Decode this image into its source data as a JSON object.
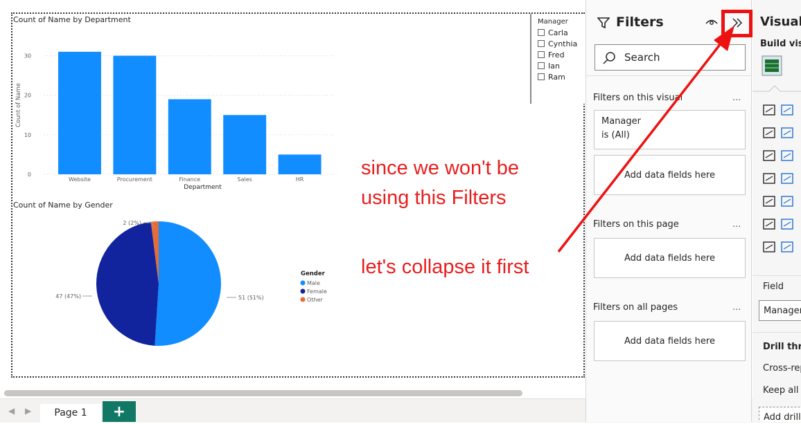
{
  "charts": {
    "bar": {
      "title": "Count of Name by Department",
      "ylabel": "Count of Name",
      "xlabel": "Department",
      "yticks": [
        "0",
        "10",
        "20",
        "30"
      ]
    },
    "pie": {
      "title": "Count of Name by Gender",
      "legend_title": "Gender",
      "legend": [
        "Male",
        "Female",
        "Other"
      ],
      "labels": [
        "51 (51%)",
        "47 (47%)",
        "2 (2%)"
      ]
    }
  },
  "chart_data": [
    {
      "type": "bar",
      "title": "Count of Name by Department",
      "xlabel": "Department",
      "ylabel": "Count of Name",
      "categories": [
        "Website",
        "Procurement",
        "Finance",
        "Sales",
        "HR"
      ],
      "values": [
        31,
        30,
        19,
        15,
        5
      ],
      "ylim": [
        0,
        35
      ],
      "color": "#118dff",
      "grid": true
    },
    {
      "type": "pie",
      "title": "Count of Name by Gender",
      "categories": [
        "Male",
        "Female",
        "Other"
      ],
      "values": [
        51,
        47,
        2
      ],
      "colors": [
        "#118dff",
        "#12239e",
        "#e66c37"
      ],
      "legend_position": "right"
    }
  ],
  "slicer": {
    "title": "Manager",
    "items": [
      "Carla",
      "Cynthia",
      "Fred",
      "Ian",
      "Ram"
    ]
  },
  "annotation": {
    "line1": "since we won't be",
    "line2": "using this Filters",
    "line3": "let's collapse it first",
    "color": "#e81e1e"
  },
  "filters": {
    "title": "Filters",
    "search_placeholder": "Search",
    "section_visual": "Filters on this visual",
    "card_field": "Manager",
    "card_state": "is (All)",
    "add_fields": "Add data fields here",
    "section_page": "Filters on this page",
    "section_all": "Filters on all pages",
    "more": "..."
  },
  "visualizations": {
    "title": "Visualizations",
    "build_visual": "Build visual",
    "field": "Field",
    "field_value": "Manager",
    "drill_through": "Drill through",
    "cross_report": "Cross-report",
    "keep_all": "Keep all filters",
    "add_drill": "Add drill-through fields here"
  },
  "pages": {
    "tab": "Page 1",
    "add": "+"
  }
}
